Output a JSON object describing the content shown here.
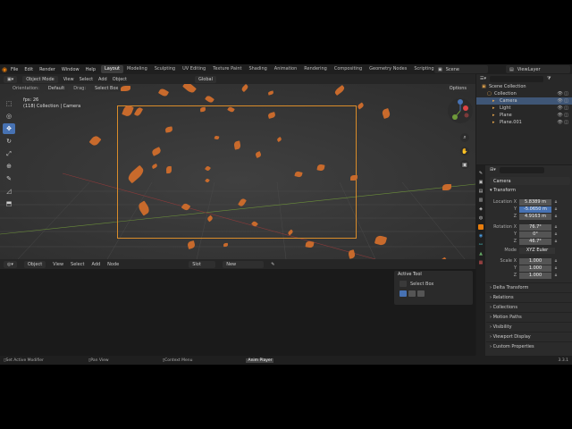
{
  "menu": [
    "File",
    "Edit",
    "Render",
    "Window",
    "Help"
  ],
  "workspaces": [
    "Layout",
    "Modeling",
    "Sculpting",
    "UV Editing",
    "Texture Paint",
    "Shading",
    "Animation",
    "Rendering",
    "Compositing",
    "Geometry Nodes",
    "Scripting"
  ],
  "active_workspace": "Layout",
  "scene": "Scene",
  "view_layer": "ViewLayer",
  "viewport": {
    "mode": "Object Mode",
    "menus": [
      "View",
      "Select",
      "Add",
      "Object"
    ],
    "transform": "Global",
    "orientation_label": "Orientation:",
    "orientation_value": "Default",
    "drag_label": "Drag:",
    "drag_value": "Select Box",
    "options": "Options",
    "fps": "fps: 26",
    "info": "(118) Collection | Camera"
  },
  "node_editor": {
    "type": "Object",
    "menus": [
      "View",
      "Select",
      "Add",
      "Node"
    ],
    "slot": "Slot",
    "new": "New"
  },
  "active_tool": {
    "title": "Active Tool",
    "tool": "Select Box"
  },
  "outliner": {
    "rows": [
      {
        "label": "Scene Collection",
        "indent": 0,
        "selected": false
      },
      {
        "label": "Collection",
        "indent": 1,
        "selected": false
      },
      {
        "label": "Camera",
        "indent": 2,
        "selected": true
      },
      {
        "label": "Light",
        "indent": 2,
        "selected": false
      },
      {
        "label": "Plane",
        "indent": 2,
        "selected": false
      },
      {
        "label": "Plane.001",
        "indent": 2,
        "selected": false
      }
    ]
  },
  "properties": {
    "object_name": "Camera",
    "transform_header": "Transform",
    "location": {
      "label": "Location X",
      "x": "5.8389 m",
      "y": "-5.0650 m",
      "z": "4.9163 m"
    },
    "rotation": {
      "label": "Rotation X",
      "x": "76.7°",
      "y": "0°",
      "z": "46.7°"
    },
    "mode_label": "Mode",
    "mode_value": "XYZ Euler",
    "scale": {
      "label": "Scale X",
      "x": "1.000",
      "y": "1.000",
      "z": "1.000"
    },
    "sections": [
      "Delta Transform",
      "Relations",
      "Collections",
      "Motion Paths",
      "Visibility",
      "Viewport Display",
      "Custom Properties"
    ]
  },
  "status": {
    "item1": "Set Active Modifier",
    "item2": "Pan View",
    "item3": "Context Menu",
    "item4": "Anim Player",
    "version": "3.3.1"
  },
  "colors": {
    "accent_blue": "#4772b3",
    "leaf_orange": "#c86a2c",
    "camera_frame": "#d98c2a"
  }
}
